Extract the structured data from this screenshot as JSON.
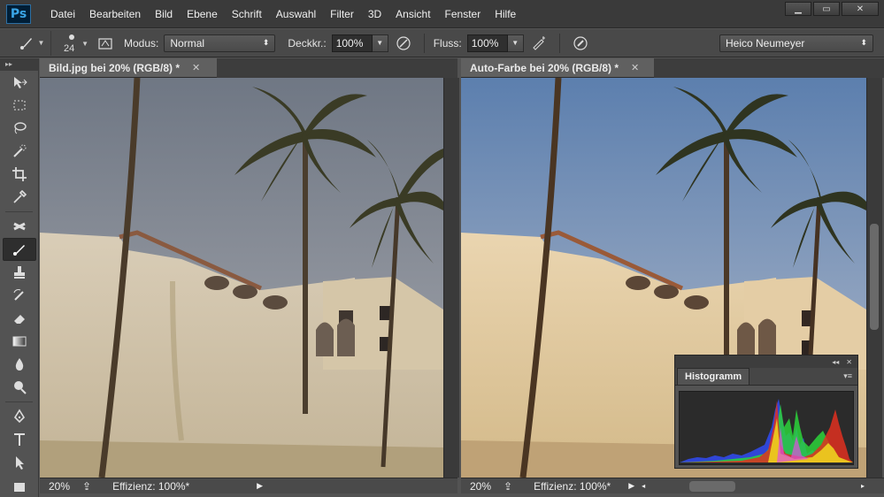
{
  "app": {
    "logo": "Ps"
  },
  "menu": [
    "Datei",
    "Bearbeiten",
    "Bild",
    "Ebene",
    "Schrift",
    "Auswahl",
    "Filter",
    "3D",
    "Ansicht",
    "Fenster",
    "Hilfe"
  ],
  "options": {
    "brush_size": "24",
    "mode_label": "Modus:",
    "mode_value": "Normal",
    "opacity_label": "Deckkr.:",
    "opacity_value": "100%",
    "flow_label": "Fluss:",
    "flow_value": "100%",
    "workspace_value": "Heico Neumeyer"
  },
  "docs": [
    {
      "title": "Bild.jpg bei 20% (RGB/8) *",
      "zoom": "20%",
      "efficiency": "Effizienz: 100%*"
    },
    {
      "title": "Auto-Farbe bei 20% (RGB/8) *",
      "zoom": "20%",
      "efficiency": "Effizienz: 100%*"
    }
  ],
  "histogram": {
    "title": "Histogramm"
  },
  "colors": {
    "menubar": "#3a3a3a",
    "panel": "#535353",
    "accent": "#3aa5e6"
  }
}
